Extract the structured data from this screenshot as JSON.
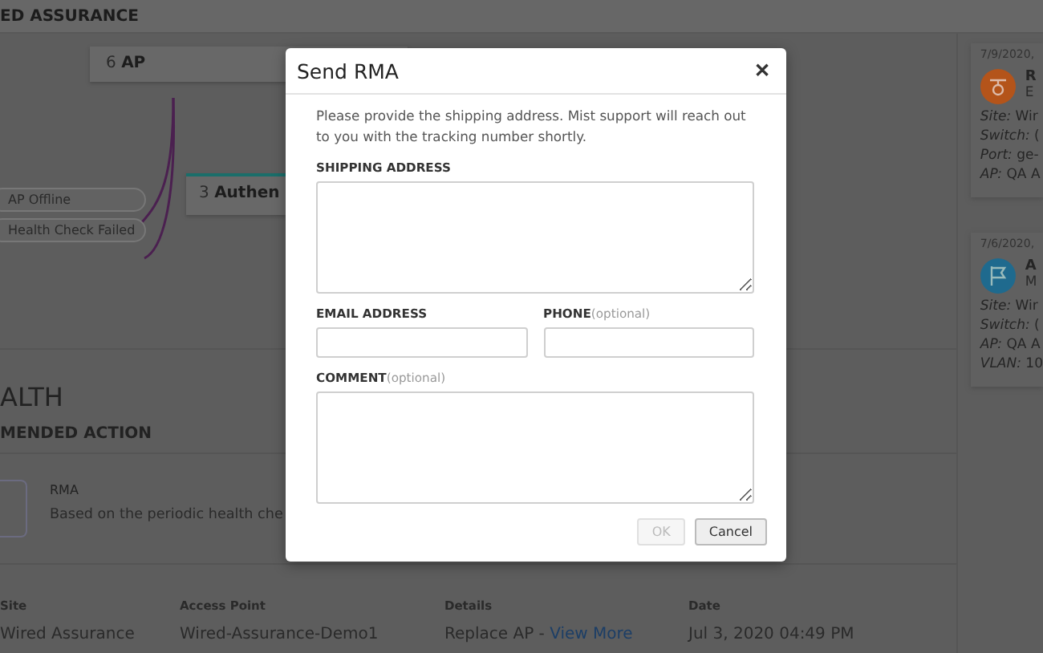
{
  "header": {
    "title": "ED ASSURANCE"
  },
  "topology": {
    "nodes": [
      {
        "count": "6",
        "label": "AP",
        "kind": "plain"
      },
      {
        "count": "3",
        "label": "Authen",
        "kind": "accent"
      }
    ],
    "statuses": [
      {
        "label": "AP Offline"
      },
      {
        "label": "Health Check Failed"
      }
    ]
  },
  "section": {
    "title": "ALTH",
    "subtitle": "MENDED ACTION"
  },
  "action": {
    "title": "RMA",
    "description": "Based on the periodic health che"
  },
  "table": {
    "columns": [
      "Site",
      "Access Point",
      "Details",
      "Date"
    ],
    "rows": [
      {
        "site": "Wired Assurance",
        "access_point": "Wired-Assurance-Demo1",
        "details": "Replace AP - ",
        "link": "View More",
        "date": "Jul 3, 2020 04:49 PM"
      }
    ]
  },
  "events": [
    {
      "date": "7/9/2020,",
      "title": "R",
      "subtitle": "E",
      "color": "#b4541a",
      "fields": [
        {
          "label": "Site:",
          "value": "Wir"
        },
        {
          "label": "Switch:",
          "value": "("
        },
        {
          "label": "Port:",
          "value": "ge-"
        },
        {
          "label": "AP:",
          "value": "QA A"
        }
      ]
    },
    {
      "date": "7/6/2020,",
      "title": "A",
      "subtitle": "M",
      "color": "#1f6a8e",
      "fields": [
        {
          "label": "Site:",
          "value": "Wir"
        },
        {
          "label": "Switch:",
          "value": "("
        },
        {
          "label": "AP:",
          "value": "QA A"
        },
        {
          "label": "VLAN:",
          "value": "10"
        }
      ]
    }
  ],
  "dialog": {
    "title": "Send RMA",
    "close": "✕",
    "message": "Please provide the shipping address. Mist support will reach out to you with the tracking number shortly.",
    "fields": [
      {
        "label": "SHIPPING ADDRESS",
        "kind": "textarea"
      },
      {
        "label": "EMAIL ADDRESS",
        "kind": "input"
      },
      {
        "label": "PHONE",
        "hint": "(optional)",
        "kind": "input"
      },
      {
        "label": "COMMENT",
        "hint": "(optional)",
        "kind": "textarea"
      }
    ],
    "buttons": [
      {
        "label": "OK",
        "disabled": true
      },
      {
        "label": "Cancel",
        "disabled": false
      }
    ]
  }
}
